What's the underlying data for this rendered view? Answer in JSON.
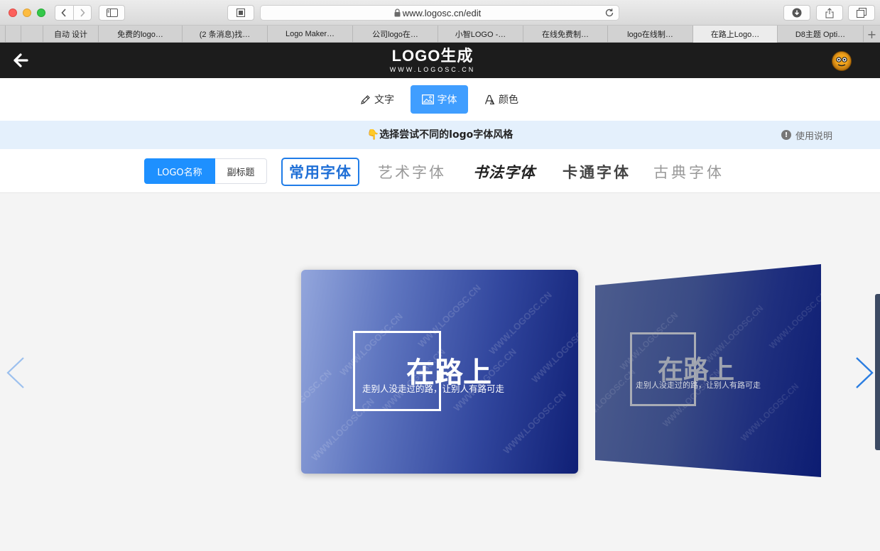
{
  "browser": {
    "url": "www.logosc.cn/edit",
    "tabs": [
      {
        "label": "",
        "active": false
      },
      {
        "label": "",
        "active": false
      },
      {
        "label": "自动 设计",
        "active": false
      },
      {
        "label": "免费的logo…",
        "active": false
      },
      {
        "label": "(2 条消息)找…",
        "active": false
      },
      {
        "label": "Logo Maker…",
        "active": false
      },
      {
        "label": "公司logo在…",
        "active": false
      },
      {
        "label": "小智LOGO -…",
        "active": false
      },
      {
        "label": "在线免费制…",
        "active": false
      },
      {
        "label": "logo在线制…",
        "active": false
      },
      {
        "label": "在路上Logo…",
        "active": true
      },
      {
        "label": "D8主题 Opti…",
        "active": false
      }
    ],
    "new_tab": "+"
  },
  "site": {
    "logo_main": "LOGO生成",
    "logo_sub": "WWW.LOGOSC.CN"
  },
  "editor_tabs": {
    "text": "文字",
    "font": "字体",
    "color": "颜色"
  },
  "hint": {
    "emoji": "👇",
    "text": "选择尝试不同的logo字体风格",
    "help": "使用说明"
  },
  "target_segment": {
    "logo_name": "LOGO名称",
    "subtitle": "副标题"
  },
  "font_styles": {
    "common": "常用字体",
    "art": "艺术字体",
    "calligraphy": "书法字体",
    "cartoon": "卡通字体",
    "classic": "古典字体"
  },
  "preview": {
    "title": "在路上",
    "slogan": "走别人没走过的路，让别人有路可走",
    "watermark": "WWW.LOGOSC.CN"
  },
  "colors": {
    "accent": "#409eff",
    "header_bg": "#1c1c1c",
    "hint_bg": "#e4f0fc"
  }
}
